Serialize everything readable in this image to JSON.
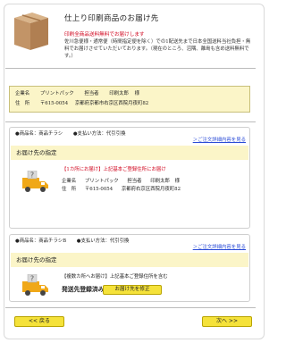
{
  "header": {
    "title": "仕上り印刷商品のお届け先",
    "notice": "印刷全商品送料無料でお届けします",
    "description": "佐川急便様・通常便（時間指定便を除く）での1配送先まで日本全国送料当社負担・無料でお届けさせていただいております。（現在のところ、沼隅、離島も含め送料無料です。）"
  },
  "address": {
    "company_label": "企業名",
    "company": "プリントパック",
    "person_label": "担当者",
    "person": "印刷太郎",
    "honorific": "様",
    "addr_label": "住　所",
    "postal": "〒615-0054",
    "address": "京都府京都市右京区西院月夜町82"
  },
  "items": [
    {
      "product": "●商品名：商品チラシ",
      "payment": "●支払い方法：代引引換",
      "link": "＞ご注文詳細内容を見る",
      "band": "お届け先の指定",
      "destination_note": "【1カ所にお届け】上記基本ご登録住所にお届け",
      "company_label": "企業名",
      "company": "プリントパック",
      "person_label": "担当者",
      "person": "印刷太郎",
      "honorific": "様",
      "addr_label": "住　所",
      "postal": "〒615-0054",
      "address": "京都府右京区西院月夜町82"
    },
    {
      "product": "●商品名：商品チラシB",
      "payment": "●支払い方法：代引引換",
      "link": "＞ご注文詳細内容を見る",
      "band": "お届け先の指定",
      "destination_note": "【複数カ所へお届け】上記基本ご登録住所を含む",
      "done_label": "発送先登録済み",
      "fix_button": "お届け先を修正"
    }
  ],
  "nav": {
    "back": "<< 戻る",
    "next": "次へ >>"
  },
  "colors": {
    "accent_yellow": "#f5e23a",
    "highlight_bg": "#fbf5c8",
    "notice_red": "#d0021b",
    "link_blue": "#2a4bd7",
    "truck_orange": "#f0a818"
  }
}
